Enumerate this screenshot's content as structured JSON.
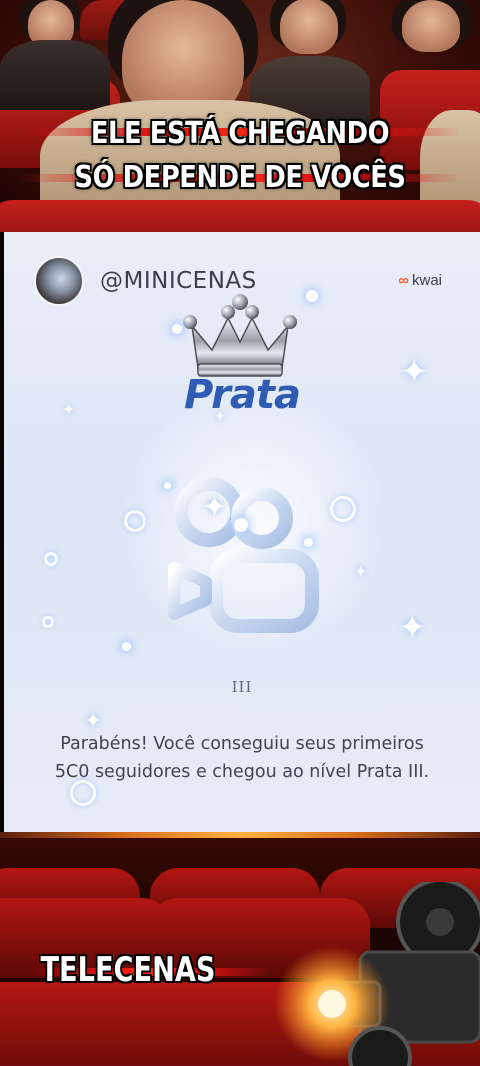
{
  "top_banner": {
    "line1": "ELE ESTÁ CHEGANDO",
    "line2": "SÓ DEPENDE DE VOCÊS"
  },
  "card": {
    "username": "@MINICENAS",
    "brand_logo_text": "kwai",
    "tier_name": "Prata",
    "tier_level": "III",
    "message_line1": "Parabéns! Você conseguiu seus primeiros",
    "message_line2": "5C0 seguidores e chegou ao nível Prata III.",
    "accent_color": "#2f5bb2",
    "brand_color": "#ff5a2a",
    "icons": [
      "crown-icon",
      "kwai-camera-icon",
      "sparkle-icon"
    ]
  },
  "bottom_banner": {
    "brand": "TELECENAS",
    "icons": [
      "projector-icon"
    ]
  }
}
